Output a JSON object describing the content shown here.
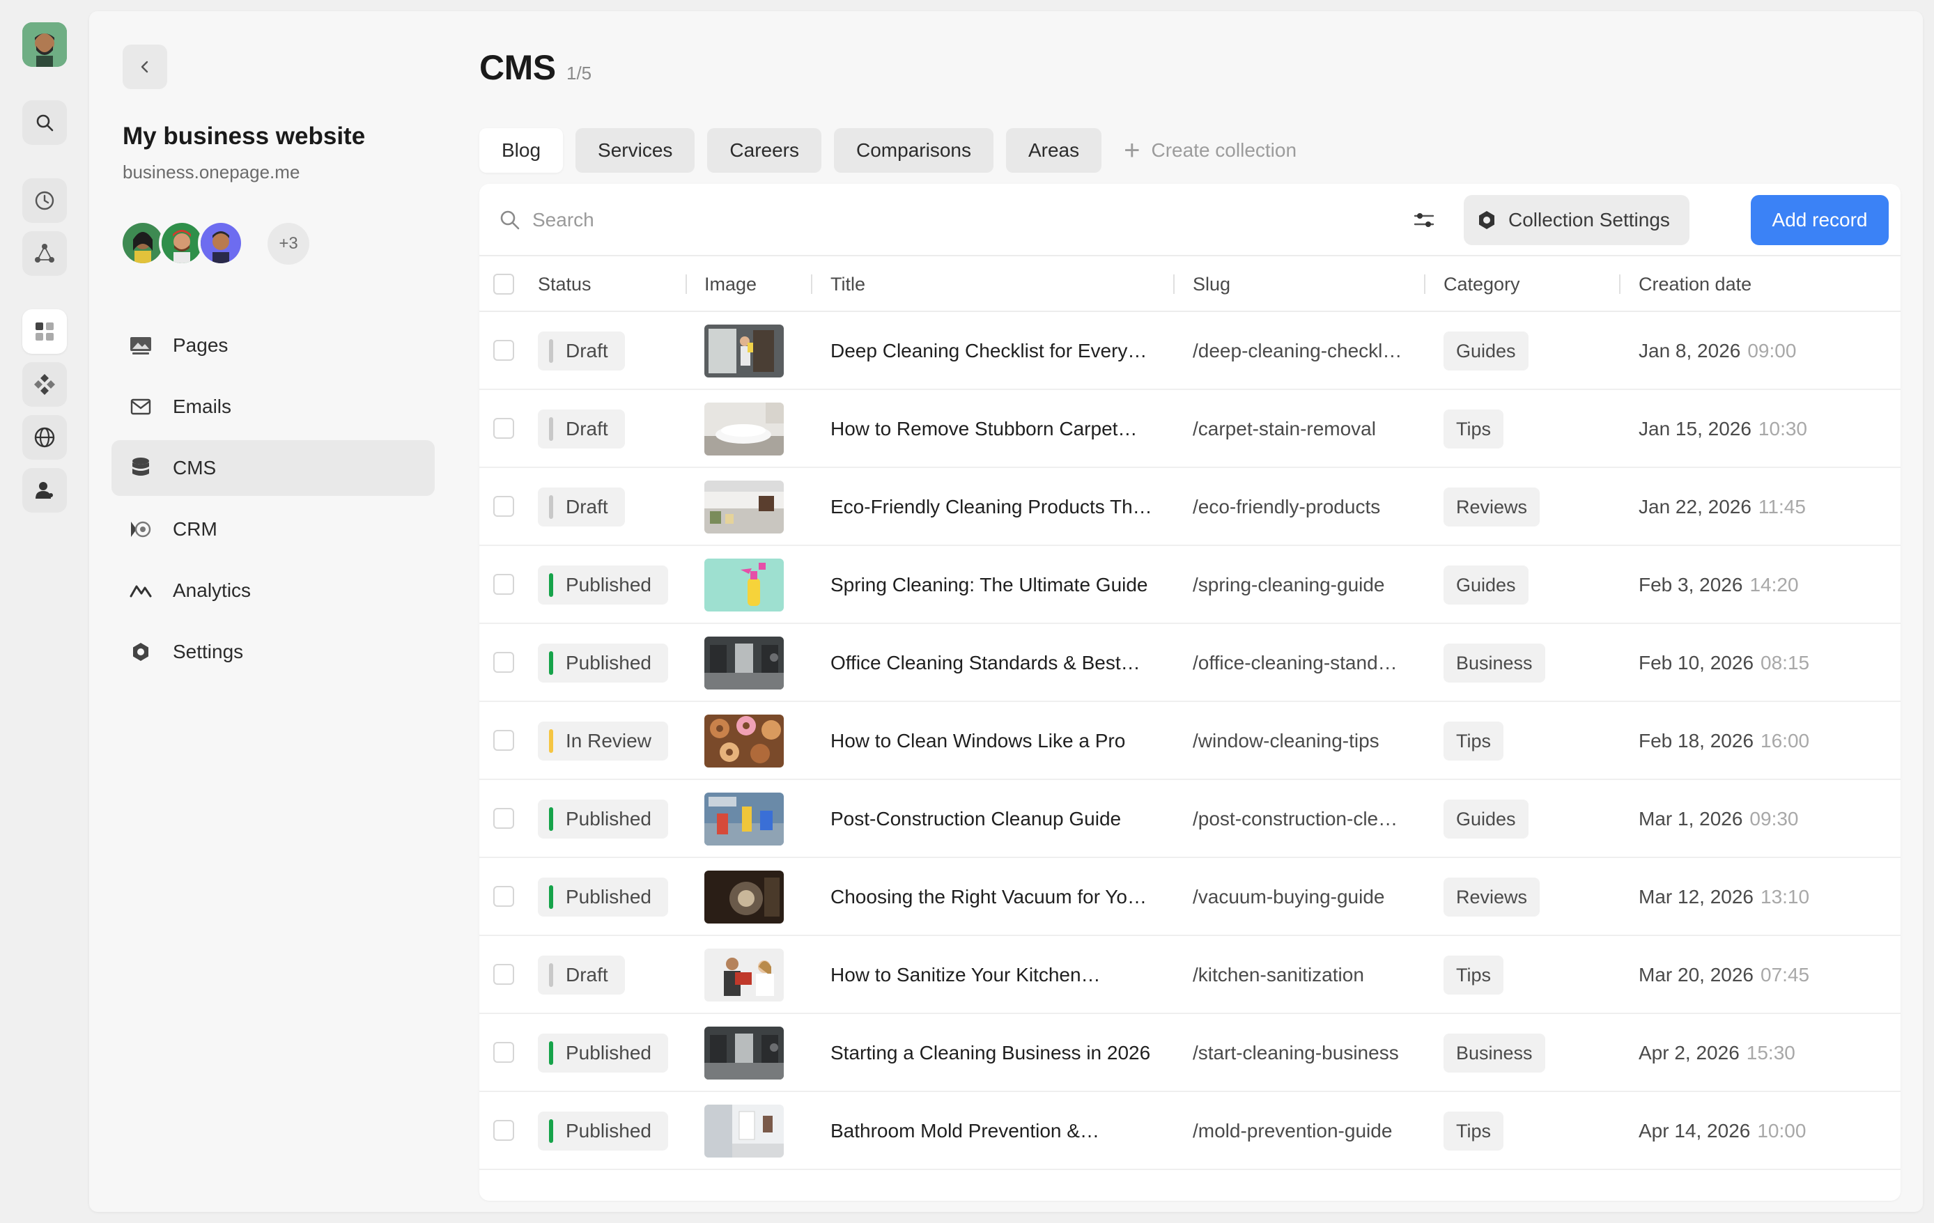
{
  "site": {
    "name": "My business website",
    "domain": "business.onepage.me",
    "members_more": "+3"
  },
  "nav": [
    {
      "label": "Pages",
      "icon": "image-icon"
    },
    {
      "label": "Emails",
      "icon": "mail-icon"
    },
    {
      "label": "CMS",
      "icon": "database-icon"
    },
    {
      "label": "CRM",
      "icon": "crm-icon"
    },
    {
      "label": "Analytics",
      "icon": "analytics-icon"
    },
    {
      "label": "Settings",
      "icon": "gear-icon"
    }
  ],
  "header": {
    "title": "CMS",
    "count": "1/5"
  },
  "tabs": [
    "Blog",
    "Services",
    "Careers",
    "Comparisons",
    "Areas"
  ],
  "create_collection": "Create collection",
  "toolbar": {
    "search_placeholder": "Search",
    "collection_settings": "Collection Settings",
    "add_record": "Add record"
  },
  "table": {
    "columns": [
      "Status",
      "Image",
      "Title",
      "Slug",
      "Category",
      "Creation date"
    ],
    "rows": [
      {
        "status": "Draft",
        "title": "Deep Cleaning Checklist for Every…",
        "slug": "/deep-cleaning-checkl…",
        "category": "Guides",
        "date": "Jan 8, 2026",
        "time": "09:00"
      },
      {
        "status": "Draft",
        "title": "How to Remove Stubborn Carpet…",
        "slug": "/carpet-stain-removal",
        "category": "Tips",
        "date": "Jan 15, 2026",
        "time": "10:30"
      },
      {
        "status": "Draft",
        "title": "Eco-Friendly Cleaning Products Th…",
        "slug": "/eco-friendly-products",
        "category": "Reviews",
        "date": "Jan 22, 2026",
        "time": "11:45"
      },
      {
        "status": "Published",
        "title": "Spring Cleaning: The Ultimate Guide",
        "slug": "/spring-cleaning-guide",
        "category": "Guides",
        "date": "Feb 3, 2026",
        "time": "14:20"
      },
      {
        "status": "Published",
        "title": "Office Cleaning Standards & Best…",
        "slug": "/office-cleaning-stand…",
        "category": "Business",
        "date": "Feb 10, 2026",
        "time": "08:15"
      },
      {
        "status": "In Review",
        "title": "How to Clean Windows Like a Pro",
        "slug": "/window-cleaning-tips",
        "category": "Tips",
        "date": "Feb 18, 2026",
        "time": "16:00"
      },
      {
        "status": "Published",
        "title": "Post-Construction Cleanup Guide",
        "slug": "/post-construction-cle…",
        "category": "Guides",
        "date": "Mar 1, 2026",
        "time": "09:30"
      },
      {
        "status": "Published",
        "title": "Choosing the Right Vacuum for Yo…",
        "slug": "/vacuum-buying-guide",
        "category": "Reviews",
        "date": "Mar 12, 2026",
        "time": "13:10"
      },
      {
        "status": "Draft",
        "title": "How to Sanitize Your Kitchen…",
        "slug": "/kitchen-sanitization",
        "category": "Tips",
        "date": "Mar 20, 2026",
        "time": "07:45"
      },
      {
        "status": "Published",
        "title": "Starting a Cleaning Business in 2026",
        "slug": "/start-cleaning-business",
        "category": "Business",
        "date": "Apr 2, 2026",
        "time": "15:30"
      },
      {
        "status": "Published",
        "title": "Bathroom Mold Prevention &…",
        "slug": "/mold-prevention-guide",
        "category": "Tips",
        "date": "Apr 14, 2026",
        "time": "10:00"
      }
    ]
  },
  "colors": {
    "accent": "#3b82f6",
    "draft": "#c8c8c8",
    "published": "#16a34a",
    "in_review": "#f5c542"
  }
}
